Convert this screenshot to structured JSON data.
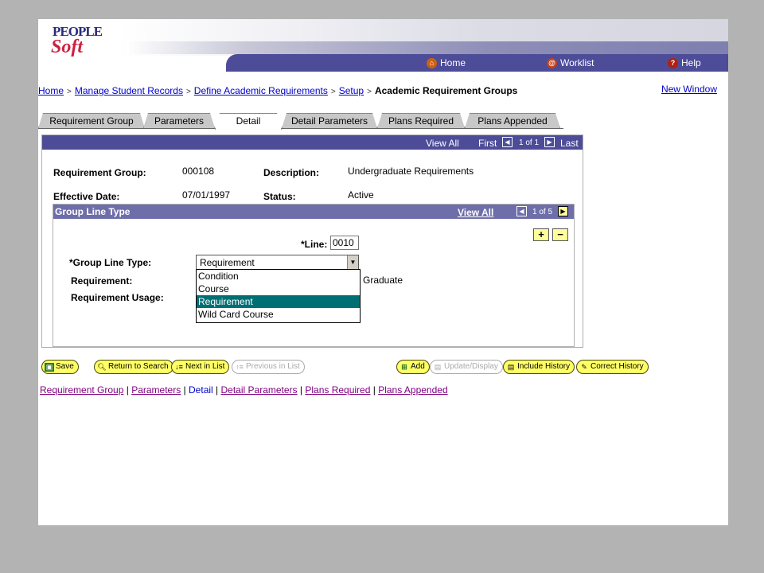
{
  "header": {
    "logo_top": "PEOPLE",
    "logo_bottom": "Soft",
    "home": "Home",
    "worklist": "Worklist",
    "help": "Help"
  },
  "breadcrumb": {
    "items": [
      "Home",
      "Manage Student Records",
      "Define Academic Requirements",
      "Setup"
    ],
    "current": "Academic Requirement Groups",
    "separator": ">"
  },
  "new_window": "New Window",
  "tabs": [
    {
      "label": "Requirement Group",
      "active": false
    },
    {
      "label": "Parameters",
      "active": false
    },
    {
      "label": "Detail",
      "active": true
    },
    {
      "label": "Detail Parameters",
      "active": false
    },
    {
      "label": "Plans Required",
      "active": false
    },
    {
      "label": "Plans Appended",
      "active": false
    }
  ],
  "topbar": {
    "view_all": "View All",
    "first": "First",
    "counter": "1 of 1",
    "last": "Last"
  },
  "form": {
    "req_group_label": "Requirement Group:",
    "req_group_value": "000108",
    "description_label": "Description:",
    "description_value": "Undergraduate Requirements",
    "eff_date_label": "Effective Date:",
    "eff_date_value": "07/01/1997",
    "status_label": "Status:",
    "status_value": "Active"
  },
  "group_line": {
    "title": "Group Line Type",
    "view_all": "View All",
    "counter": "1 of 5",
    "line_label": "*Line:",
    "line_value": "0010",
    "type_label": "*Group Line Type:",
    "type_value": "Requirement",
    "requirement_label": "Requirement:",
    "requirement_value": "Graduate",
    "usage_label": "Requirement Usage:",
    "add_symbol": "+",
    "remove_symbol": "−",
    "options": [
      "Condition",
      "Course",
      "Requirement",
      "Wild Card Course"
    ],
    "selected_option": "Requirement"
  },
  "buttons": {
    "save": "Save",
    "return_search": "Return to Search",
    "next_list": "Next in List",
    "prev_list": "Previous in List",
    "add": "Add",
    "update_display": "Update/Display",
    "include_history": "Include History",
    "correct_history": "Correct History"
  },
  "bottom_links": [
    "Requirement Group",
    "Parameters",
    "Detail",
    "Detail Parameters",
    "Plans Required",
    "Plans Appended"
  ],
  "colors": {
    "nav": "#4c4c98",
    "subheader": "#6e6eaa",
    "selected_option": "#006f73",
    "button": "#ffff66"
  }
}
